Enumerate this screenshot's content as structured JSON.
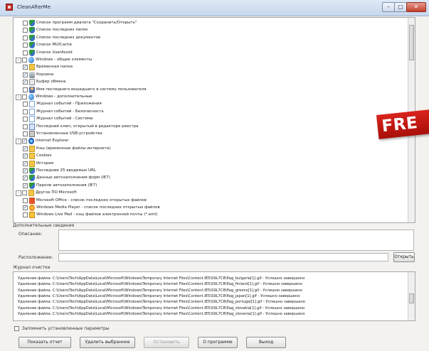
{
  "window": {
    "title": "CleanAfterMe",
    "minimize_glyph": "–",
    "maximize_glyph": "□",
    "close_glyph": "✕"
  },
  "tree": {
    "items": [
      {
        "label": "Список программ диалога \"Сохранить/Открыть\"",
        "level": 1,
        "checked": false,
        "icon": "shield-icon"
      },
      {
        "label": "Список последних папок",
        "level": 1,
        "checked": false,
        "icon": "shield-icon"
      },
      {
        "label": "Список последних документов",
        "level": 1,
        "checked": false,
        "icon": "shield-icon"
      },
      {
        "label": "Список MUICache",
        "level": 1,
        "checked": false,
        "icon": "shield-icon"
      },
      {
        "label": "Список UserAssist",
        "level": 1,
        "checked": false,
        "icon": "shield-icon"
      },
      {
        "label": "Windows - общие элементы",
        "level": 0,
        "checked": false,
        "icon": "globe-icon",
        "expander": "-"
      },
      {
        "label": "Временная папка",
        "level": 1,
        "checked": true,
        "icon": "folder-icon"
      },
      {
        "label": "Корзина",
        "level": 1,
        "checked": true,
        "icon": "trash-icon"
      },
      {
        "label": "Буфер обмена",
        "level": 1,
        "checked": true,
        "icon": "clipboard-icon"
      },
      {
        "label": "Имя последнего вошедшего в систему пользователя",
        "level": 1,
        "checked": false,
        "icon": "user-icon"
      },
      {
        "label": "Windows - дополнительные",
        "level": 0,
        "checked": false,
        "icon": "globe-icon",
        "expander": "-"
      },
      {
        "label": "Журнал событий - Приложения",
        "level": 1,
        "checked": false,
        "icon": "document-icon"
      },
      {
        "label": "Журнал событий - Безопасность",
        "level": 1,
        "checked": false,
        "icon": "document-icon"
      },
      {
        "label": "Журнал событий - Система",
        "level": 1,
        "checked": false,
        "icon": "document-icon"
      },
      {
        "label": "Последний ключ, открытый в редакторе реестра",
        "level": 1,
        "checked": false,
        "icon": "edit-icon"
      },
      {
        "label": "Установленные USB-устройства",
        "level": 1,
        "checked": false,
        "icon": "usb-icon"
      },
      {
        "label": "Internet Explorer",
        "level": 0,
        "checked": true,
        "icon": "ie-icon",
        "expander": "-"
      },
      {
        "label": "Кэш (временные файлы интернета)",
        "level": 1,
        "checked": true,
        "icon": "folder-icon"
      },
      {
        "label": "Cookies",
        "level": 1,
        "checked": true,
        "icon": "folder-icon"
      },
      {
        "label": "История",
        "level": 1,
        "checked": true,
        "icon": "folder-icon"
      },
      {
        "label": "Последние 25 вводимых URL",
        "level": 1,
        "checked": true,
        "icon": "shield-icon"
      },
      {
        "label": "Данные автозаполнения форм (IE7)",
        "level": 1,
        "checked": true,
        "icon": "shield-icon"
      },
      {
        "label": "Пароли автозаполнения (IE7)",
        "level": 1,
        "checked": true,
        "icon": "shield-icon"
      },
      {
        "label": "Другое ПО Microsoft",
        "level": 0,
        "checked": false,
        "icon": "folder-icon",
        "expander": "-"
      },
      {
        "label": "Microsoft Office - список последних открытых файлов",
        "level": 1,
        "checked": false,
        "icon": "office-icon"
      },
      {
        "label": "Windows Media Player - список последних открытых файлов",
        "level": 1,
        "checked": true,
        "icon": "media-player-icon"
      },
      {
        "label": "Windows Live Mail - кэш файлов электронной почты (*.eml)",
        "level": 1,
        "checked": false,
        "icon": "mail-icon"
      }
    ]
  },
  "details": {
    "section_label": "Дополнительные сведения",
    "description_label": "Описание:",
    "location_label": "Расположение:",
    "open_button_label": "Открыть"
  },
  "log": {
    "section_label": "Журнал очистки",
    "lines": [
      "Удаление файла: C:\\Users\\Tech\\AppData\\Local\\Microsoft\\Windows\\Temporary Internet Files\\Content.IE5\\S9L7C8\\flag_bulgaria[1].gif  -  Успешно завершено",
      "Удаление файла: C:\\Users\\Tech\\AppData\\Local\\Microsoft\\Windows\\Temporary Internet Files\\Content.IE5\\S9L7C8\\flag_finland[1].gif  -  Успешно завершено",
      "Удаление файла: C:\\Users\\Tech\\AppData\\Local\\Microsoft\\Windows\\Temporary Internet Files\\Content.IE5\\S9L7C8\\flag_greece[1].gif  -  Успешно завершено",
      "Удаление файла: C:\\Users\\Tech\\AppData\\Local\\Microsoft\\Windows\\Temporary Internet Files\\Content.IE5\\S9L7C8\\flag_japan[1].gif  -  Успешно завершено",
      "Удаление файла: C:\\Users\\Tech\\AppData\\Local\\Microsoft\\Windows\\Temporary Internet Files\\Content.IE5\\S9L7C8\\flag_portugal[1].gif  -  Успешно завершено",
      "Удаление файла: C:\\Users\\Tech\\AppData\\Local\\Microsoft\\Windows\\Temporary Internet Files\\Content.IE5\\S9L7C8\\flag_slovakia[1].gif  -  Успешно завершено",
      "Удаление файла: C:\\Users\\Tech\\AppData\\Local\\Microsoft\\Windows\\Temporary Internet Files\\Content.IE5\\S9L7C8\\flag_slovenia[1].gif  -  Успешно завершено"
    ]
  },
  "footer": {
    "remember_label": "Запомнить установленные параметры",
    "remember_checked": false,
    "buttons": {
      "report": "Показать отчет",
      "delete_selected": "Удалить выбранное",
      "stop": "Остановить",
      "about": "О программе",
      "exit": "Выход"
    }
  },
  "overlay": {
    "badge_text": "FRE",
    "badge_color": "#d9241c"
  }
}
